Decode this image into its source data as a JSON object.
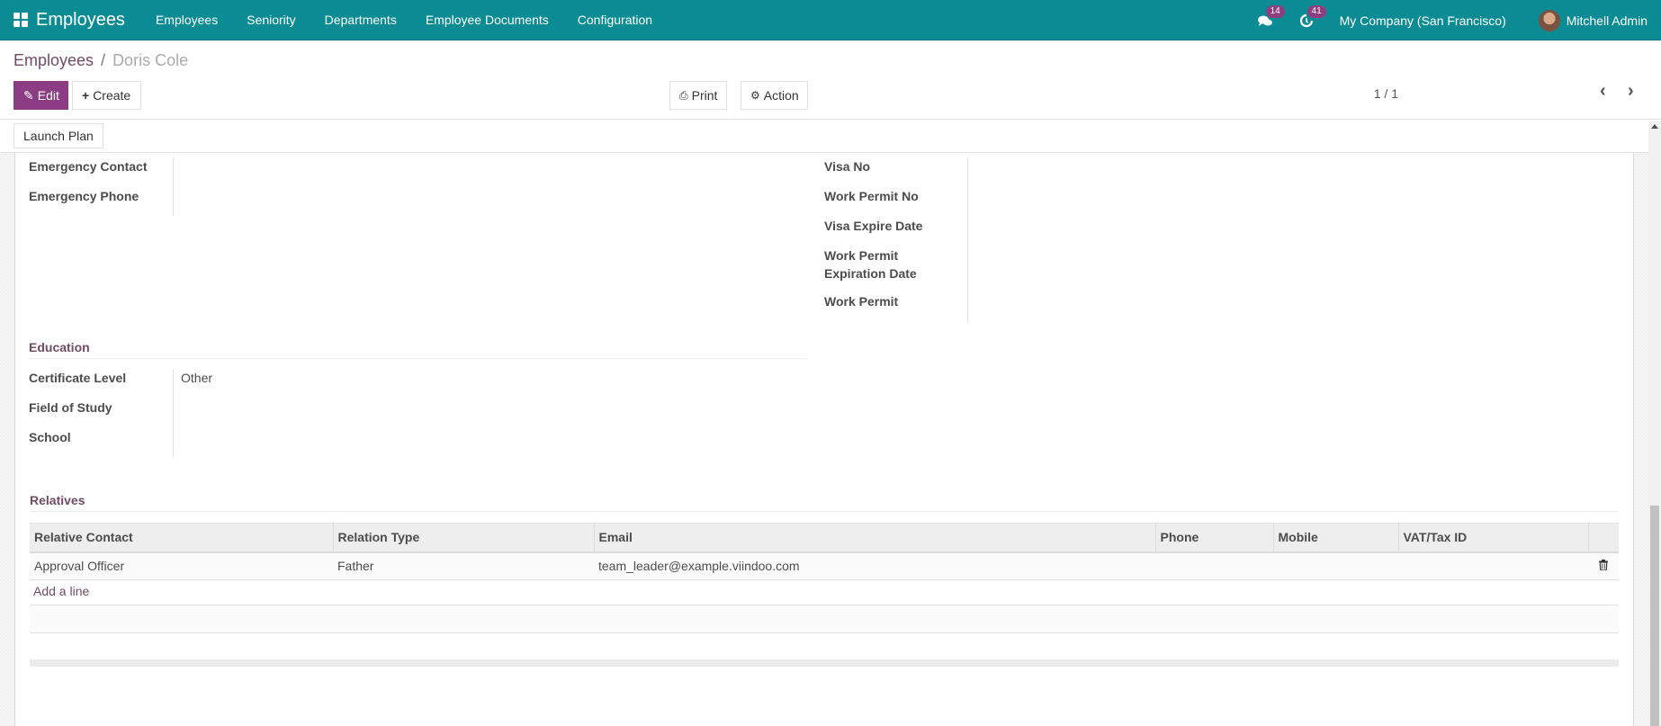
{
  "navbar": {
    "app_title": "Employees",
    "menu": [
      "Employees",
      "Seniority",
      "Departments",
      "Employee Documents",
      "Configuration"
    ],
    "messages_count": "14",
    "activities_count": "41",
    "company": "My Company (San Francisco)",
    "user": "Mitchell Admin",
    "accent_color": "#0b8c95",
    "badge_color": "#8f3f80"
  },
  "breadcrumb": {
    "parent": "Employees",
    "separator": "/",
    "current": "Doris Cole"
  },
  "toolbar": {
    "edit_label": "Edit",
    "create_label": "Create",
    "print_label": "Print",
    "action_label": "Action",
    "pager": "1 / 1",
    "primary_color": "#8b3c82"
  },
  "statusbar": {
    "launch_plan_label": "Launch Plan"
  },
  "form": {
    "left_fields": [
      {
        "label": "Emergency Contact",
        "value": ""
      },
      {
        "label": "Emergency Phone",
        "value": ""
      }
    ],
    "right_fields": [
      {
        "label": "Visa No",
        "value": ""
      },
      {
        "label": "Work Permit No",
        "value": ""
      },
      {
        "label": "Visa Expire Date",
        "value": ""
      },
      {
        "label": "Work Permit Expiration Date",
        "value": ""
      },
      {
        "label": "Work Permit",
        "value": ""
      }
    ],
    "education": {
      "title": "Education",
      "fields": [
        {
          "label": "Certificate Level",
          "value": "Other"
        },
        {
          "label": "Field of Study",
          "value": ""
        },
        {
          "label": "School",
          "value": ""
        }
      ]
    },
    "relatives": {
      "title": "Relatives",
      "columns": [
        "Relative Contact",
        "Relation Type",
        "Email",
        "Phone",
        "Mobile",
        "VAT/Tax ID"
      ],
      "rows": [
        {
          "relative_contact": "Approval Officer",
          "relation_type": "Father",
          "email": "team_leader@example.viindoo.com",
          "phone": "",
          "mobile": "",
          "vat": ""
        }
      ],
      "add_line_label": "Add a line"
    }
  }
}
